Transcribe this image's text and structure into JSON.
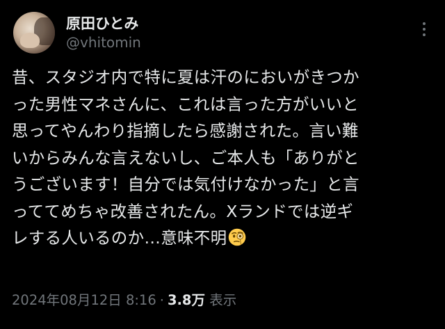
{
  "author": {
    "display_name": "原田ひとみ",
    "handle": "@vhitomin"
  },
  "tweet": {
    "lines": [
      "昔、スタジオ内で特に夏は汗のにおいがきつか",
      "った男性マネさんに、これは言った方がいいと",
      "思ってやんわり指摘したら感謝された。言い難",
      "いからみんな言えないし、ご本人も「ありがと",
      "うございます！自分では気付けなかった」と言",
      "っててめちゃ改善されたん。Xランドでは逆ギ",
      "レする人いるのか…意味不明"
    ],
    "emoji": "face-with-monocle"
  },
  "meta": {
    "timestamp": "2024年08月12日 8:16",
    "separator": "·",
    "views_count": "3.8万",
    "views_label": "表示"
  },
  "icons": {
    "more": "more-horizontal-icon",
    "avatar": "avatar"
  },
  "colors": {
    "background": "#000000",
    "text_primary": "#e7e9ea",
    "text_secondary": "#71767b"
  }
}
